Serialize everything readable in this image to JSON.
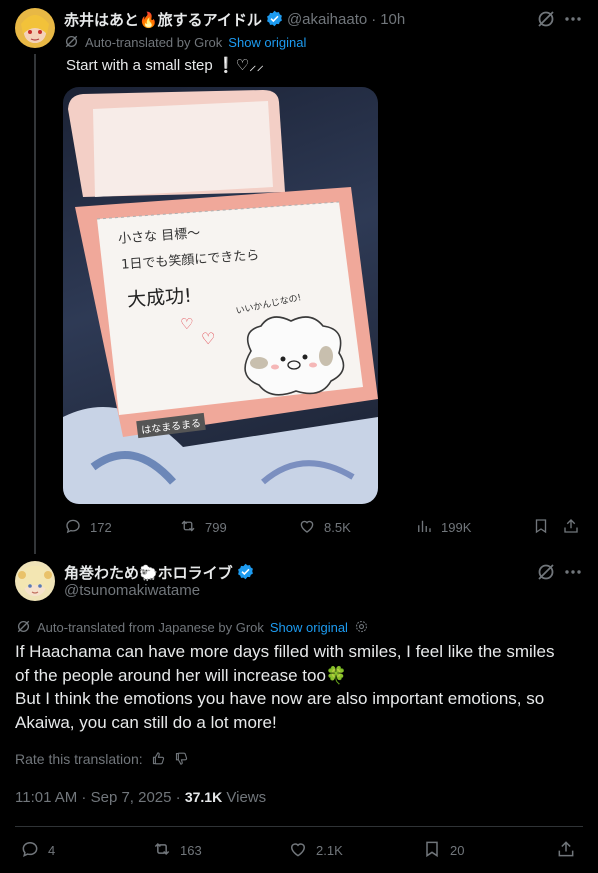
{
  "post1": {
    "display_name": "赤井はあと🔥旅するアイドル",
    "handle": "@akaihaato",
    "dot": "·",
    "time": "10h",
    "translated_label": "Auto-translated by Grok",
    "show_original": "Show original",
    "text": "Start with a small step ❕♡⸝⸝",
    "image": {
      "note_lines": [
        "小さな 目標〜",
        "1日でも笑顔にできたら",
        "大成功!"
      ],
      "character_bubble": "いいかんじなの!",
      "footer_stamp": "はなまるまる"
    },
    "stats": {
      "replies": "172",
      "reposts": "799",
      "likes": "8.5K",
      "views": "199K"
    }
  },
  "post2": {
    "display_name": "角巻わため🐑ホロライブ",
    "handle": "@tsunomakiwatame",
    "translated_label": "Auto-translated from Japanese by Grok",
    "show_original": "Show original",
    "text_lines": [
      "If Haachama can have more days filled with smiles, I feel like the smiles",
      "of the people around her will increase too🍀",
      "But I think the emotions you have now are also important emotions, so",
      "Akaiwa, you can still do a lot more!"
    ],
    "rate_label": "Rate this translation:",
    "timestamp": "11:01 AM · Sep 7, 2025 ·",
    "views_count": "37.1K",
    "views_label": "Views",
    "stats": {
      "replies": "4",
      "reposts": "163",
      "likes": "2.1K",
      "bookmarks": "20"
    }
  },
  "colors": {
    "background": "#000000",
    "text": "#e7e9ea",
    "muted": "#71767b",
    "accent": "#1d9bf0",
    "divider": "#2f3336"
  },
  "icons": [
    "grok-icon",
    "more-icon",
    "reply-icon",
    "repost-icon",
    "like-icon",
    "views-icon",
    "bookmark-icon",
    "share-icon",
    "verified-icon",
    "settings-icon",
    "thumbs-up-icon",
    "thumbs-down-icon"
  ]
}
